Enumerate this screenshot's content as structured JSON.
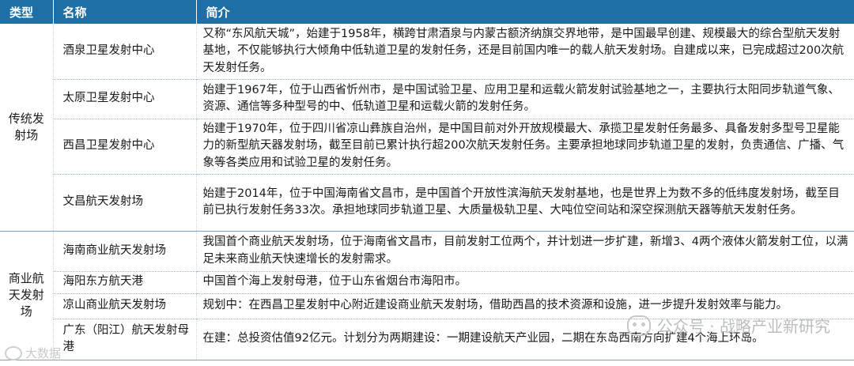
{
  "header": {
    "type": "类型",
    "name": "名称",
    "desc": "简介"
  },
  "sections": [
    {
      "type": "传统发射场",
      "rows": [
        {
          "name": "酒泉卫星发射中心",
          "desc": "又称“东风航天城”，始建于1958年，横跨甘肃酒泉与内蒙古额济纳旗交界地带，是中国最早创建、规模最大的综合型航天发射基地，不仅能够执行大倾角中低轨道卫星的发射任务，还是目前国内唯一的载人航天发射场。自建成以来，已完成超过200次航天发射任务。"
        },
        {
          "name": "太原卫星发射中心",
          "desc": "始建于1967年，位于山西省忻州市，是中国试验卫星、应用卫星和运载火箭发射试验基地之一，主要执行太阳同步轨道气象、资源、通信等多种型号的中、低轨道卫星和运载火箭的发射任务。"
        },
        {
          "name": "西昌卫星发射中心",
          "desc": "始建于1970年，位于四川省凉山彝族自治州，是中国目前对外开放规模最大、承揽卫星发射任务最多、具备发射多型号卫星能力的新型航天器发射场，截至目前已累计执行超200次航天发射任务。主要承担地球同步轨道卫星的发射，负责通信、广播、气象等各类应用和试验卫星的发射任务。"
        },
        {
          "name": "文昌航天发射场",
          "desc": "始建于2014年，位于中国海南省文昌市，是中国首个开放性滨海航天发射基地，也是世界上为数不多的低纬度发射场，截至目前已执行发射任务33次。承担地球同步轨道卫星、大质量极轨卫星、大吨位空间站和深空探测航天器等航天发射任务。"
        }
      ]
    },
    {
      "type": "商业航天发射场",
      "rows": [
        {
          "name": "海南商业航天发射场",
          "desc": "我国首个商业航天发射场，位于海南省文昌市，目前发射工位两个，并计划进一步扩建，新增3、4两个液体火箭发射工位，以满足未来商业航天快速增长的发射需求。"
        },
        {
          "name": "海阳东方航天港",
          "desc": "中国首个海上发射母港，位于山东省烟台市海阳市。"
        },
        {
          "name": "凉山商业航天发射场",
          "desc": "规划中：在西昌卫星发射中心附近建设商业航天发射场，借助西昌的技术资源和设施，进一步提升发射效率与能力。"
        },
        {
          "name": "广东（阳江）航天发射母港",
          "desc": "在建：总投资估值92亿元。计划分为两期建设：一期建设航天产业园，二期在东岛西南方向扩建4个海上环岛。"
        }
      ]
    }
  ],
  "watermarks": {
    "main": "公众号 · 战略产业新研究",
    "corner": "大数据"
  }
}
